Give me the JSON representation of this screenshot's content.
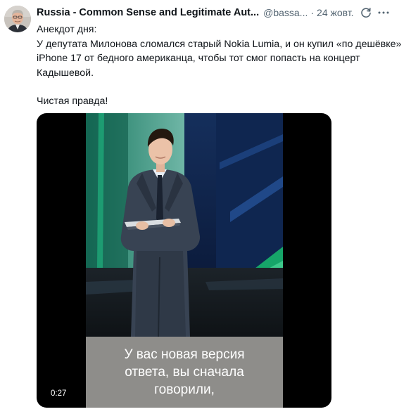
{
  "post": {
    "author_name": "Russia - Common Sense and Legitimate Aut...",
    "handle": "@bassa...",
    "separator": "·",
    "date": "24 жовт.",
    "body_lines": [
      "Анекдот дня:",
      "У депутата Милонова сломался старый Nokia Lumia, и он купил «по дешёвке» iPhone 17 от бедного американца, чтобы тот смог попасть на концерт Кадышевой."
    ],
    "closing_line": "Чистая правда!"
  },
  "video": {
    "caption": "У вас новая версия ответа, вы сначала говорили,",
    "duration": "0:27"
  },
  "icons": {
    "avatar": "avatar-photo",
    "refresh": "refresh-icon",
    "menu": "kebab-menu-icon"
  },
  "colors": {
    "text": "#0f1419",
    "secondary_text": "#536471",
    "video_background": "#000000",
    "caption_background": "#8e8d8a"
  }
}
